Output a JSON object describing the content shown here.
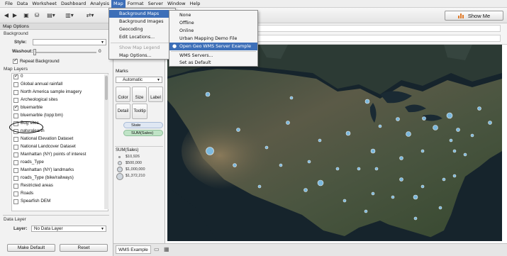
{
  "menubar": {
    "items": [
      "File",
      "Data",
      "Worksheet",
      "Dashboard",
      "Analysis",
      "Map",
      "Format",
      "Server",
      "Window",
      "Help"
    ],
    "active_index": 5
  },
  "toolbar": {
    "show_me_label": "Show Me"
  },
  "map_options": {
    "panel_title": "Map Options",
    "background_section": "Background",
    "style_label": "Style:",
    "washout_label": "Washout:",
    "washout_value": "0",
    "repeat_background_label": "Repeat Background",
    "repeat_background_checked": true,
    "map_layers_section": "Map Layers",
    "layers": [
      {
        "label": "0",
        "checked": true
      },
      {
        "label": "Global annual rainfall",
        "checked": false
      },
      {
        "label": "North America sample imagery",
        "checked": false
      },
      {
        "label": "Archeological sites",
        "checked": false
      },
      {
        "label": "bluemarble",
        "checked": true
      },
      {
        "label": "bluemarble (topp:bm)",
        "checked": false
      },
      {
        "label": "Bug sites",
        "checked": false
      },
      {
        "label": "naturalearth",
        "checked": false
      },
      {
        "label": "National Elevation Dataset",
        "checked": false
      },
      {
        "label": "National Landcover Dataset",
        "checked": false
      },
      {
        "label": "Manhattan (NY) points of interest",
        "checked": false
      },
      {
        "label": "roads_Type",
        "checked": false
      },
      {
        "label": "Manhattan (NY) landmarks",
        "checked": false
      },
      {
        "label": "roads_Type (bike/railways)",
        "checked": false
      },
      {
        "label": "Restricted areas",
        "checked": false
      },
      {
        "label": "Roads",
        "checked": false
      },
      {
        "label": "Spearfish DEM",
        "checked": false
      }
    ],
    "data_layer_section": "Data Layer",
    "layer_label": "Layer:",
    "layer_value": "No Data Layer",
    "make_default_label": "Make Default",
    "reset_label": "Reset"
  },
  "marks": {
    "title": "Marks",
    "mark_type": "Automatic",
    "buttons": [
      "Color",
      "Size",
      "Label",
      "Detail",
      "Tooltip"
    ],
    "pills": [
      "State",
      "SUM(Sales)"
    ],
    "legend_title": "SUM(Sales)",
    "legend_values": [
      "$10,926",
      "$500,000",
      "$1,000,000",
      "$1,372,210"
    ]
  },
  "map_menu": {
    "items": [
      {
        "label": "Background Maps",
        "submenu": true,
        "active": true
      },
      {
        "label": "Background Images",
        "submenu": true
      },
      {
        "label": "Geocoding",
        "submenu": true
      },
      {
        "label": "Edit Locations..."
      },
      {
        "label": "Show Map Legend",
        "disabled": true
      },
      {
        "label": "Map Options..."
      }
    ]
  },
  "background_maps_submenu": {
    "items": [
      {
        "label": "None"
      },
      {
        "label": "Offline"
      },
      {
        "label": "Online"
      },
      {
        "label": "Urban Mapping Demo File"
      },
      {
        "label": "Open Geo WMS Server Example",
        "selected": true,
        "active": true
      },
      {
        "label": "WMS Servers..."
      },
      {
        "label": "Set as Default"
      }
    ]
  },
  "tabs": {
    "sheet_label": "WMS Example"
  },
  "colors": {
    "menu_highlight": "#3d6fb8",
    "map_marker": "#7fc3ee",
    "panel_bg": "#f2f2f2"
  }
}
